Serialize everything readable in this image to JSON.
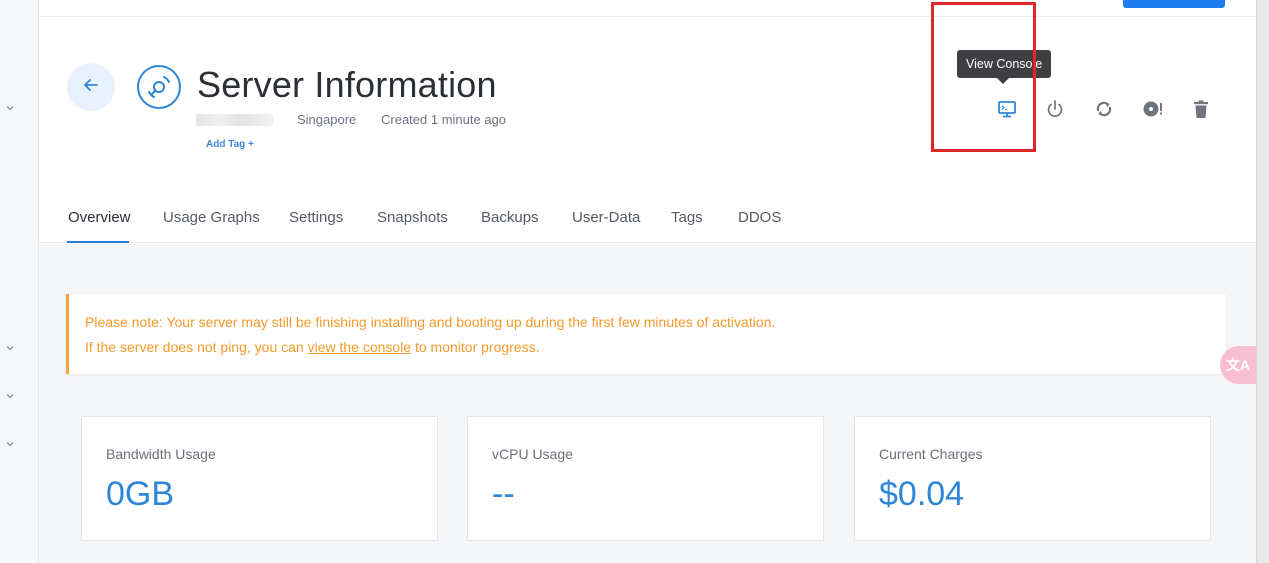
{
  "header": {
    "title": "Server Information",
    "location": "Singapore",
    "created": "Created 1 minute ago",
    "add_tag": "Add Tag +"
  },
  "icons": {
    "back": "arrow-left-icon",
    "server": "disc-icon",
    "console": "monitor-icon",
    "power": "power-icon",
    "restart": "refresh-icon",
    "reinstall": "disc-warning-icon",
    "destroy": "trash-icon"
  },
  "tooltip": {
    "text": "View Console"
  },
  "tabs": [
    {
      "label": "Overview",
      "active": true
    },
    {
      "label": "Usage Graphs"
    },
    {
      "label": "Settings"
    },
    {
      "label": "Snapshots"
    },
    {
      "label": "Backups"
    },
    {
      "label": "User-Data"
    },
    {
      "label": "Tags"
    },
    {
      "label": "DDOS"
    }
  ],
  "notice": {
    "line1": "Please note: Your server may still be finishing installing and booting up during the first few minutes of activation.",
    "line2_before": "If the server does not ping, you can ",
    "line2_link": "view the console",
    "line2_after": " to monitor progress."
  },
  "cards": [
    {
      "label": "Bandwidth Usage",
      "value": "0GB"
    },
    {
      "label": "vCPU Usage",
      "value": "--"
    },
    {
      "label": "Current Charges",
      "value": "$0.04"
    }
  ],
  "translate_fab": {
    "label": "文A"
  },
  "colors": {
    "accent": "#2f86d9",
    "notice": "#f39a2b",
    "highlight": "#e0262d",
    "tooltip_bg": "#3d3f43"
  }
}
